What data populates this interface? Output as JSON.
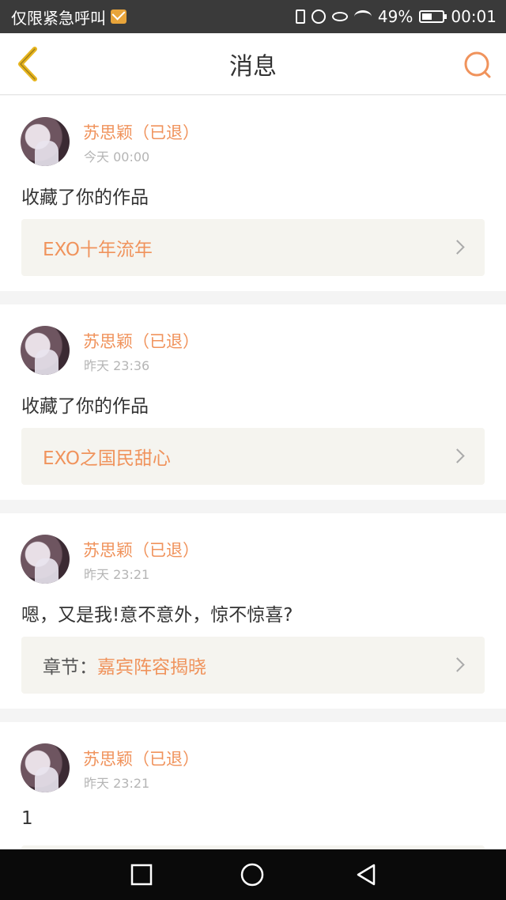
{
  "status_bar": {
    "carrier_text": "仅限紧急呼叫",
    "battery_percent": "49%",
    "time": "00:01"
  },
  "header": {
    "title": "消息"
  },
  "messages": [
    {
      "user": "苏思颖（已退）",
      "time": "今天 00:00",
      "text": "收藏了你的作品",
      "link_prefix": "",
      "link_title": "EXO十年流年"
    },
    {
      "user": "苏思颖（已退）",
      "time": "昨天 23:36",
      "text": "收藏了你的作品",
      "link_prefix": "",
      "link_title": "EXO之国民甜心"
    },
    {
      "user": "苏思颖（已退）",
      "time": "昨天 23:21",
      "text": "嗯，又是我!意不意外，惊不惊喜?",
      "link_prefix": "章节：",
      "link_title": "嘉宾阵容揭晓"
    },
    {
      "user": "苏思颖（已退）",
      "time": "昨天 23:21",
      "text": "1"
    }
  ],
  "colors": {
    "accent": "#f0935c",
    "back_arrow": "#e7b51f",
    "search_icon": "#f0935c"
  }
}
